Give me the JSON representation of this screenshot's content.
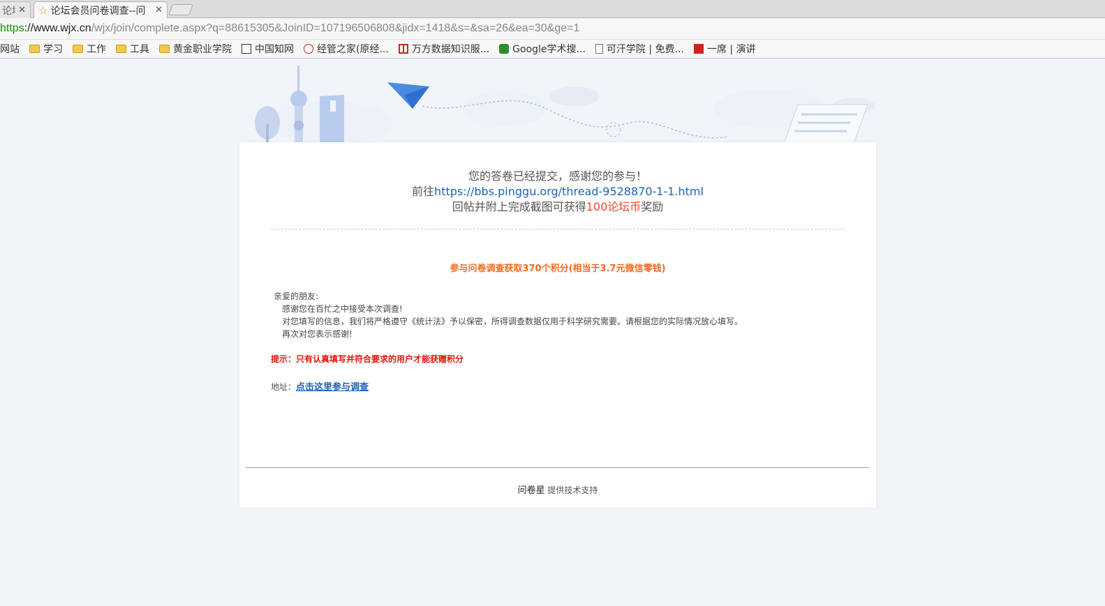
{
  "browser": {
    "tabs": [
      {
        "label": "论坛"
      },
      {
        "label": "论坛会员问卷调查--问"
      }
    ],
    "url": {
      "scheme": "https",
      "host": "://www.wjx.cn",
      "path": "/wjx/join/complete.aspx?q=88615305&JoinID=107196506808&jidx=1418&s=&sa=26&ea=30&ge=1"
    },
    "bookmarks": [
      {
        "label": "网站",
        "icon": "none"
      },
      {
        "label": "学习",
        "icon": "folder-icon"
      },
      {
        "label": "工作",
        "icon": "folder-icon"
      },
      {
        "label": "工具",
        "icon": "folder-icon"
      },
      {
        "label": "黄金职业学院",
        "icon": "folder-icon"
      },
      {
        "label": "中国知网",
        "icon": "cnki-icon"
      },
      {
        "label": "经管之家(原经...",
        "icon": "jg-icon"
      },
      {
        "label": "万方数据知识服...",
        "icon": "wanfang-icon"
      },
      {
        "label": "Google学术搜...",
        "icon": "google-scholar-icon"
      },
      {
        "label": "可汗学院 | 免费...",
        "icon": "page-icon"
      },
      {
        "label": "一席 | 演讲",
        "icon": "yixi-icon"
      }
    ]
  },
  "page": {
    "thanks_line1": "您的答卷已经提交，感谢您的参与！",
    "thanks_line2_prefix": "前往",
    "thanks_line2_link": "https://bbs.pinggu.org/thread-9528870-1-1.html",
    "thanks_line3_prefix": "回帖并附上完成截图可获得",
    "thanks_line3_red": "100论坛币",
    "thanks_line3_suffix": "奖励",
    "promo": "参与问卷调查获取370个积分(相当于3.7元微信零钱)",
    "letter": {
      "greeting": "亲爱的朋友:",
      "line1": "感谢您在百忙之中接受本次调查!",
      "line2": "对您填写的信息，我们将严格遵守《统计法》予以保密，所得调查数据仅用于科学研究需要。请根据您的实际情况放心填写。",
      "line3": "再次对您表示感谢!"
    },
    "tip": "提示：只有认真填写并符合要求的用户才能获赠积分",
    "addr_label": "地址：",
    "addr_link": "点击这里参与调查",
    "footer_brand": "问卷星",
    "footer_text": " 提供技术支持"
  },
  "colors": {
    "accent_link": "#1a63b7",
    "promo_orange": "#f26b1c",
    "tip_red": "#e3160b",
    "banner_blue": "#b8cdee"
  }
}
